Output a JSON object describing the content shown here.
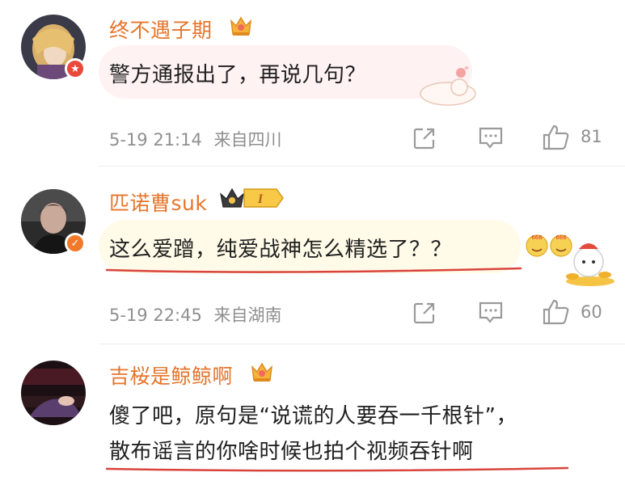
{
  "comments": [
    {
      "username": "终不遇子期",
      "text": "警方通报出了，再说几句？",
      "time": "5-19 21:14",
      "location": "来自四川",
      "likes": "81",
      "name_color": "#e5752b",
      "bubble_color": "#fff2f2"
    },
    {
      "username": "匹诺曹suk",
      "text": "这么爱蹭，纯爱战神怎么精选了？？",
      "time": "5-19 22:45",
      "location": "来自湖南",
      "likes": "60",
      "name_color": "#e5752b",
      "bubble_color": "#fffbe8",
      "level_badge": "I"
    },
    {
      "username": "吉桜是鲸鲸啊",
      "text_line1": "傻了吧，原句是“说谎的人要吞一千根针”，",
      "text_line2": "散布谣言的你啥时候也拍个视频吞针啊",
      "name_color": "#e5752b"
    }
  ],
  "colors": {
    "username": "#e5752b",
    "meta_text": "#8f8f8f",
    "icon": "#9a9a9a",
    "underline": "#d9443c",
    "vip_badge_orange": "#f07a2a",
    "vip_badge_red": "#e9483b"
  },
  "icons": {
    "share": "share-icon",
    "comment": "comment-icon",
    "like": "thumbs-up-icon",
    "crown": "crown-badge-icon"
  }
}
